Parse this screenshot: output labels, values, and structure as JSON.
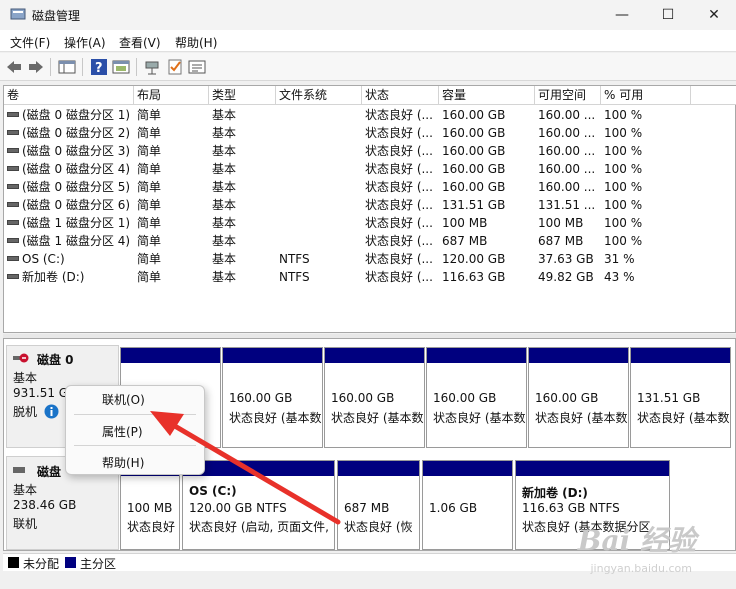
{
  "window": {
    "title": "磁盘管理",
    "min": "—",
    "max": "☐",
    "close": "✕"
  },
  "menu": [
    "文件(F)",
    "操作(A)",
    "查看(V)",
    "帮助(H)"
  ],
  "toolbar_icons": [
    "back-icon",
    "forward-icon",
    "console-tree-icon",
    "help-icon",
    "properties-icon",
    "connect-icon",
    "check-icon",
    "list-icon"
  ],
  "volume_list": {
    "columns": [
      "卷",
      "布局",
      "类型",
      "文件系统",
      "状态",
      "容量",
      "可用空间",
      "% 可用"
    ],
    "rows": [
      [
        "(磁盘 0 磁盘分区 1)",
        "简单",
        "基本",
        "",
        "状态良好 (...",
        "160.00 GB",
        "160.00 ...",
        "100 %"
      ],
      [
        "(磁盘 0 磁盘分区 2)",
        "简单",
        "基本",
        "",
        "状态良好 (...",
        "160.00 GB",
        "160.00 ...",
        "100 %"
      ],
      [
        "(磁盘 0 磁盘分区 3)",
        "简单",
        "基本",
        "",
        "状态良好 (...",
        "160.00 GB",
        "160.00 ...",
        "100 %"
      ],
      [
        "(磁盘 0 磁盘分区 4)",
        "简单",
        "基本",
        "",
        "状态良好 (...",
        "160.00 GB",
        "160.00 ...",
        "100 %"
      ],
      [
        "(磁盘 0 磁盘分区 5)",
        "简单",
        "基本",
        "",
        "状态良好 (...",
        "160.00 GB",
        "160.00 ...",
        "100 %"
      ],
      [
        "(磁盘 0 磁盘分区 6)",
        "简单",
        "基本",
        "",
        "状态良好 (...",
        "131.51 GB",
        "131.51 ...",
        "100 %"
      ],
      [
        "(磁盘 1 磁盘分区 1)",
        "简单",
        "基本",
        "",
        "状态良好 (...",
        "100 MB",
        "100 MB",
        "100 %"
      ],
      [
        "(磁盘 1 磁盘分区 4)",
        "简单",
        "基本",
        "",
        "状态良好 (...",
        "687 MB",
        "687 MB",
        "100 %"
      ],
      [
        "OS (C:)",
        "简单",
        "基本",
        "NTFS",
        "状态良好 (...",
        "120.00 GB",
        "37.63 GB",
        "31 %"
      ],
      [
        "新加卷 (D:)",
        "简单",
        "基本",
        "NTFS",
        "状态良好 (...",
        "116.63 GB",
        "49.82 GB",
        "43 %"
      ]
    ]
  },
  "disk0": {
    "name": "磁盘 0",
    "type": "基本",
    "size": "931.51 GB",
    "status": "脱机",
    "partitions": [
      {
        "size": "",
        "status": ""
      },
      {
        "size": "160.00 GB",
        "status": "状态良好 (基本数"
      },
      {
        "size": "160.00 GB",
        "status": "状态良好 (基本数"
      },
      {
        "size": "160.00 GB",
        "status": "状态良好 (基本数"
      },
      {
        "size": "160.00 GB",
        "status": "状态良好 (基本数"
      },
      {
        "size": "131.51 GB",
        "status": "状态良好 (基本数"
      }
    ]
  },
  "disk1": {
    "name": "磁盘",
    "type": "基本",
    "size": "238.46 GB",
    "status": "联机",
    "partitions": [
      {
        "name": "",
        "size": "100 MB",
        "status": "状态良好"
      },
      {
        "name": "OS  (C:)",
        "size": "120.00 GB NTFS",
        "status": "状态良好 (启动, 页面文件,"
      },
      {
        "name": "",
        "size": "687 MB",
        "status": "状态良好 (恢"
      },
      {
        "name": "",
        "size": "1.06 GB",
        "status": ""
      },
      {
        "name": "新加卷  (D:)",
        "size": "116.63 GB NTFS",
        "status": "状态良好 (基本数据分区"
      }
    ]
  },
  "context_menu": {
    "online": "联机(O)",
    "properties": "属性(P)",
    "help": "帮助(H)"
  },
  "legend": {
    "unallocated": "未分配",
    "primary": "主分区",
    "unallocated_color": "#000000",
    "primary_color": "#00007f"
  },
  "watermark": {
    "brand": "Bai 经验",
    "url": "jingyan.baidu.com"
  },
  "annotation_color": "#e8312a"
}
